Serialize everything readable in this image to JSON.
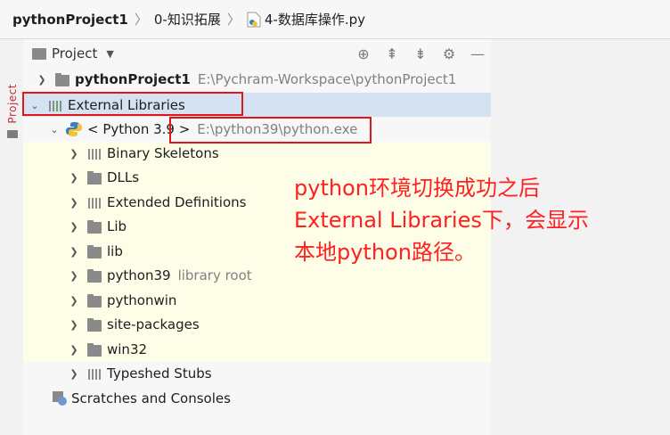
{
  "breadcrumb": {
    "project": "pythonProject1",
    "folder": "0-知识拓展",
    "file": "4-数据库操作.py"
  },
  "side_tab": {
    "label": "Project"
  },
  "panel": {
    "title": "Project",
    "tools": [
      "target-icon",
      "expand-all-icon",
      "collapse-all-icon",
      "gear-icon",
      "minimize-icon"
    ]
  },
  "tree": {
    "project_root": {
      "name": "pythonProject1",
      "path": "E:\\Pychram-Workspace\\pythonProject1"
    },
    "external_libraries": "External Libraries",
    "sdk": {
      "name": "< Python 3.9 >",
      "path": "E:\\python39\\python.exe"
    },
    "children": [
      {
        "name": "Binary Skeletons",
        "icon": "library-icon"
      },
      {
        "name": "DLLs",
        "icon": "folder-icon"
      },
      {
        "name": "Extended Definitions",
        "icon": "library-icon"
      },
      {
        "name": "Lib",
        "icon": "folder-icon"
      },
      {
        "name": "lib",
        "icon": "folder-icon"
      },
      {
        "name": "python39",
        "icon": "folder-icon",
        "note": "library root"
      },
      {
        "name": "pythonwin",
        "icon": "folder-icon"
      },
      {
        "name": "site-packages",
        "icon": "folder-icon"
      },
      {
        "name": "win32",
        "icon": "folder-icon"
      },
      {
        "name": "Typeshed Stubs",
        "icon": "library-icon"
      }
    ],
    "scratches": "Scratches and Consoles"
  },
  "annotation": {
    "line1": "python环境切换成功之后",
    "line2": "External Libraries下，会显示",
    "line3": "本地python路径。"
  },
  "colors": {
    "highlight_box": "#e0161a",
    "annotation_text": "#ff2020",
    "selection": "#d4e2f2",
    "library_root_bg": "#fdfde8"
  }
}
